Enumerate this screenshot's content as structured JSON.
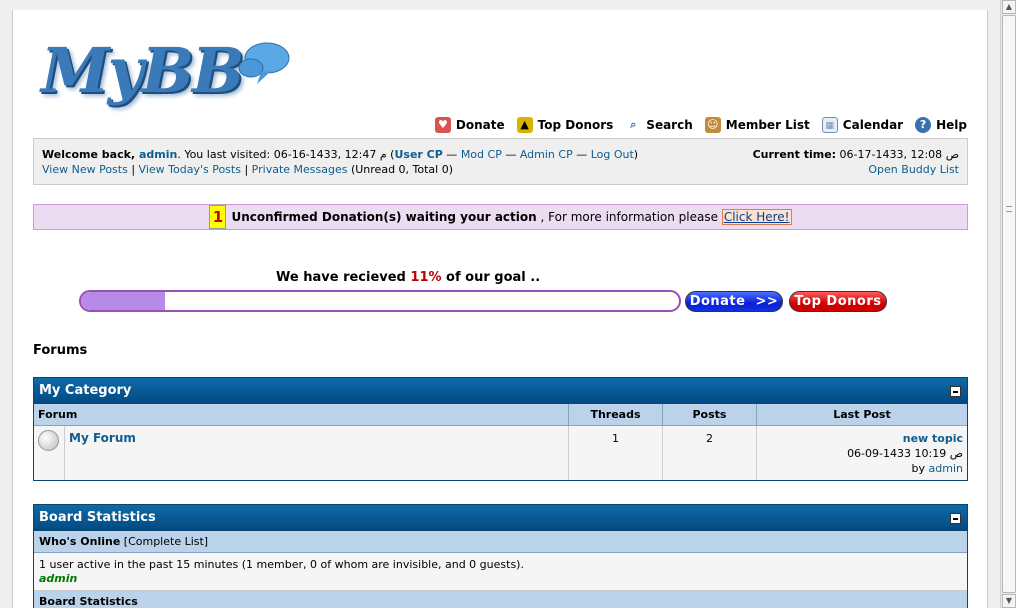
{
  "logo": {
    "text": "MyBB"
  },
  "menu": [
    {
      "label": "Donate",
      "icon": "donate-icon",
      "color": "#d9534f"
    },
    {
      "label": "Top Donors",
      "icon": "top-donors-icon",
      "color": "#d8b400"
    },
    {
      "label": "Search",
      "icon": "search-icon",
      "color": "#7aa7d4"
    },
    {
      "label": "Member List",
      "icon": "member-list-icon",
      "color": "#c48a3c"
    },
    {
      "label": "Calendar",
      "icon": "calendar-icon",
      "color": "#6f8fb5"
    },
    {
      "label": "Help",
      "icon": "help-icon",
      "color": "#3a6fb0"
    }
  ],
  "welcome": {
    "prefix": "Welcome back, ",
    "username": "admin",
    "last_visit": ". You last visited: 06-16-1433, 12:47 م (",
    "user_cp": "User CP",
    "mod_cp": "Mod CP",
    "admin_cp": "Admin CP",
    "logout": "Log Out",
    "sep": " — ",
    "close": ")",
    "view_new": "View New Posts",
    "view_today": "View Today's Posts",
    "pm": "Private Messages",
    "pm_counts": " (Unread 0, Total 0)",
    "pipe": " | ",
    "current_time_label": "Current time:",
    "current_time": " 06-17-1433, 12:08 ص",
    "buddy_list": "Open Buddy List"
  },
  "notice": {
    "count": "1",
    "text": "Unconfirmed Donation(s) waiting your action",
    "more": " , For more information please ",
    "link": "Click Here!"
  },
  "goal": {
    "prefix": "We have recieved ",
    "percent_label": "11%",
    "suffix": " of our goal ..",
    "progress": 0.14,
    "donate_button": "Donate  >>",
    "top_donors_button": "Top Donors"
  },
  "forums_title": "Forums",
  "category": {
    "name": "My Category",
    "columns": [
      "Forum",
      "Threads",
      "Posts",
      "Last Post"
    ],
    "forums": [
      {
        "name": "My Forum",
        "threads": "1",
        "posts": "2",
        "last_post_title": "new topic",
        "last_post_date": "06-09-1433 10:19 ص",
        "last_post_by": "by ",
        "last_post_user": "admin"
      }
    ]
  },
  "stats": {
    "title": "Board Statistics",
    "whos_online": "Who's Online",
    "complete_list": "[Complete List]",
    "online_text": "1 user active in the past 15 minutes (1 member, 0 of whom are invisible, and 0 guests).",
    "online_user": "admin",
    "next_section": "Board Statistics"
  }
}
